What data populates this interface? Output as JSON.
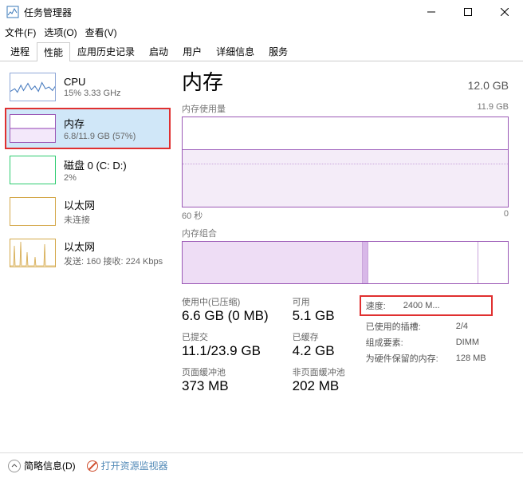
{
  "window": {
    "title": "任务管理器"
  },
  "menu": {
    "file": "文件(F)",
    "options": "选项(O)",
    "view": "查看(V)"
  },
  "tabs": {
    "processes": "进程",
    "performance": "性能",
    "app_history": "应用历史记录",
    "startup": "启动",
    "users": "用户",
    "details": "详细信息",
    "services": "服务"
  },
  "sidebar": {
    "cpu": {
      "title": "CPU",
      "sub": "15% 3.33 GHz"
    },
    "memory": {
      "title": "内存",
      "sub": "6.8/11.9 GB (57%)"
    },
    "disk": {
      "title": "磁盘 0 (C: D:)",
      "sub": "2%"
    },
    "eth1": {
      "title": "以太网",
      "sub": "未连接"
    },
    "eth2": {
      "title": "以太网",
      "sub": "发送: 160 接收: 224 Kbps"
    }
  },
  "main": {
    "title": "内存",
    "total": "12.0 GB",
    "usage_label": "内存使用量",
    "usage_max": "11.9 GB",
    "time_left": "60 秒",
    "time_right": "0",
    "composition_label": "内存组合",
    "stats": {
      "inuse_label": "使用中(已压缩)",
      "inuse_value": "6.6 GB (0 MB)",
      "available_label": "可用",
      "available_value": "5.1 GB",
      "committed_label": "已提交",
      "committed_value": "11.1/23.9 GB",
      "cached_label": "已缓存",
      "cached_value": "4.2 GB",
      "paged_label": "页面缓冲池",
      "paged_value": "373 MB",
      "nonpaged_label": "非页面缓冲池",
      "nonpaged_value": "202 MB"
    },
    "right": {
      "speed_label": "速度:",
      "speed_value": "2400 M...",
      "slots_label": "已使用的插槽:",
      "slots_value": "2/4",
      "form_label": "组成要素:",
      "form_value": "DIMM",
      "reserved_label": "为硬件保留的内存:",
      "reserved_value": "128 MB"
    }
  },
  "bottom": {
    "fewer": "简略信息(D)",
    "resmon": "打开资源监视器"
  }
}
